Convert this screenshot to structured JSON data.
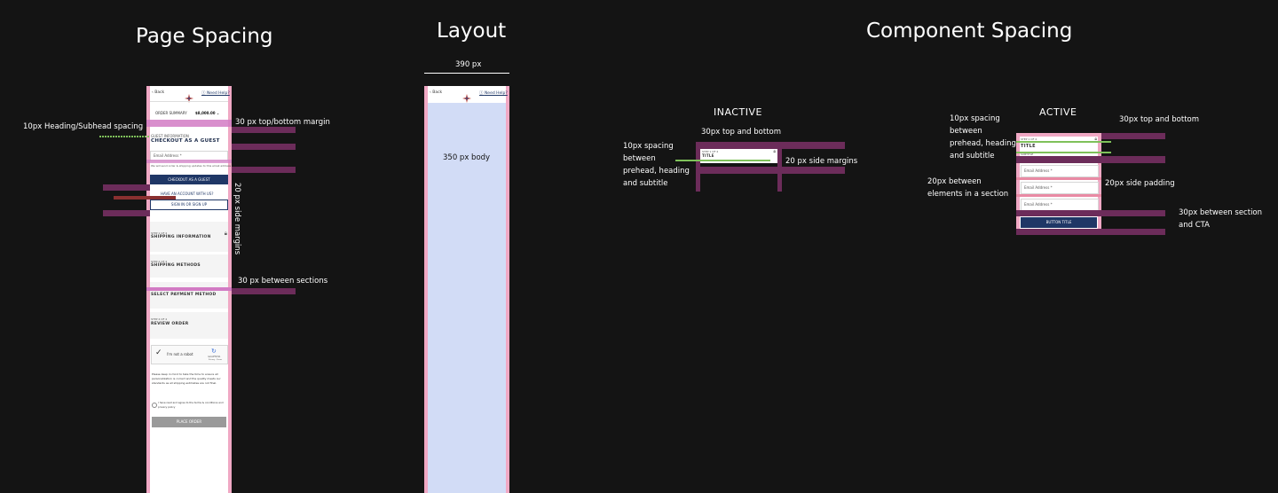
{
  "titles": {
    "page_spacing": "Page Spacing",
    "layout": "Layout",
    "component_spacing": "Component Spacing"
  },
  "page_spacing": {
    "notes": {
      "heading_subhead": "10px Heading/Subhead spacing",
      "top_bottom_margin": "30 px top/bottom margin",
      "side_margins": "20 px side margins",
      "between_sections": "30 px between sections"
    },
    "phone": {
      "back": "Back",
      "need_help": "Need Help?",
      "order_summary": "ORDER SUMMARY",
      "order_total": "$8,000.00",
      "prehead": "GUEST INFORMATION",
      "checkout_heading": "CHECKOUT AS A GUEST",
      "email_label": "Email Address *",
      "disclaimer": "We will send order & shipping updates to this email address",
      "checkout_button": "CHECKOUT AS A GUEST",
      "have_account": "HAVE AN ACCOUNT WITH US?",
      "sign_in_button": "SIGN IN OR SIGN UP",
      "sections": [
        {
          "step": "STEP 1 OF 4",
          "title": "SHIPPING INFORMATION"
        },
        {
          "step": "STEP 2 OF 4",
          "title": "SHIPPING METHODS"
        },
        {
          "step": "STEP 3 OF 4",
          "title": "SELECT PAYMENT METHOD"
        },
        {
          "step": "STEP 4 OF 4",
          "title": "REVIEW ORDER"
        }
      ],
      "captcha_label": "I'm not a robot",
      "captcha_brand": "reCAPTCHA",
      "captcha_sub": "Privacy - Terms",
      "notice": "Please keep in mind to take the time to ensure all personalization is correct and the quality meets our standards as all shipping estimates are not final.",
      "agree_text": "I have read and agree to the terms & conditions and privacy policy",
      "place_order": "PLACE ORDER"
    }
  },
  "layout": {
    "width_label": "390 px",
    "body_label": "350 px body",
    "back": "Back",
    "need_help": "Need Help?"
  },
  "component_spacing": {
    "inactive": {
      "label": "INACTIVE",
      "note_prehead": [
        "10px spacing",
        "between",
        "prehead, heading",
        "and subtitle"
      ],
      "note_top_bottom": "30px top and bottom",
      "note_side": "20 px side margins",
      "prehead": "STEP 1 OF 4",
      "title": "TITLE"
    },
    "active": {
      "label": "ACTIVE",
      "note_prehead": [
        "10px spacing",
        "between",
        "prehead, heading",
        "and subtitle"
      ],
      "note_top_bottom": "30px top and bottom",
      "note_elements": [
        "20px between",
        "elements in a section"
      ],
      "note_side_padding": "20px side padding",
      "note_cta": [
        "30px between section",
        "and CTA"
      ],
      "prehead": "STEP 1 OF 4",
      "title": "TITLE",
      "subtitle": "SUBTITLE",
      "fields": [
        "Email Address *",
        "Email Address *",
        "Email Address *"
      ],
      "button": "BUTTON TITLE"
    }
  },
  "colors": {
    "background": "#141414",
    "margin_pink": "#f0a8c4",
    "spacing_bar": "#6c2c5a",
    "spacing_bar_light": "#d27bc4",
    "green_guide": "#7fc15a",
    "body_fill": "#d2dcf6",
    "navy": "#1f3766"
  }
}
